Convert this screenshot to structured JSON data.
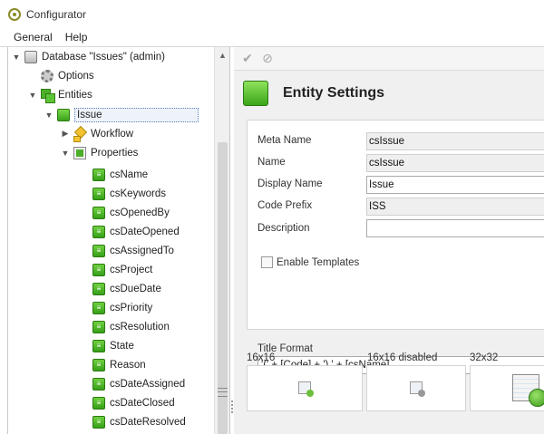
{
  "window": {
    "title": "Configurator"
  },
  "menu": [
    "General",
    "Help"
  ],
  "tree": {
    "database": "Database \"Issues\" (admin)",
    "options": "Options",
    "entities": "Entities",
    "entity": "Issue",
    "workflow": "Workflow",
    "properties": "Properties",
    "fields": [
      "csName",
      "csKeywords",
      "csOpenedBy",
      "csDateOpened",
      "csAssignedTo",
      "csProject",
      "csDueDate",
      "csPriority",
      "csResolution",
      "State",
      "Reason",
      "csDateAssigned",
      "csDateClosed",
      "csDateResolved"
    ]
  },
  "toolbar": {
    "save_glyph": "✔",
    "cancel_glyph": "⊘"
  },
  "settings": {
    "title": "Entity Settings",
    "meta_name_label": "Meta Name",
    "meta_name_value": "csIssue",
    "name_label": "Name",
    "name_value": "csIssue",
    "display_name_label": "Display Name",
    "display_name_value": "Issue",
    "code_prefix_label": "Code Prefix",
    "code_prefix_value": "ISS",
    "description_label": "Description",
    "description_value": "",
    "enable_templates_label": "Enable Templates",
    "enable_templates_checked": false,
    "title_format_label": "Title Format",
    "title_format_value": "'(' + [Code] + ') ' + [csName]"
  },
  "icons": {
    "small_label": "16x16",
    "small_disabled_label": "16x16 disabled",
    "large_label": "32x32"
  },
  "colors": {
    "accent_green": "#3aa51a",
    "selection_border": "#5a7fb8"
  }
}
